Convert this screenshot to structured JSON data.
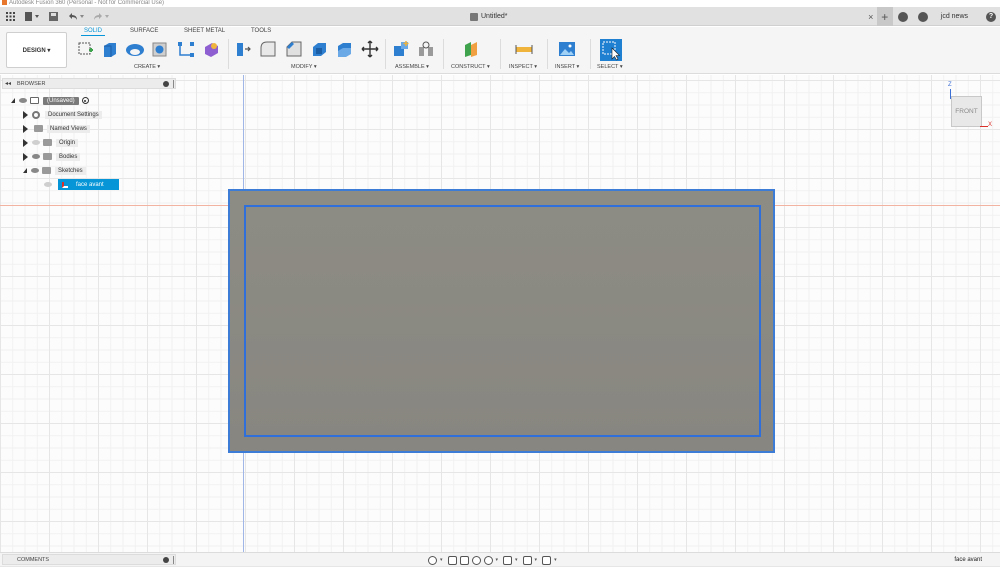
{
  "window": {
    "title": "Autodesk Fusion 360 (Personal - Not for Commercial Use)"
  },
  "topbar": {
    "document_title": "Untitled*",
    "close_glyph": "×",
    "plus_glyph": "+",
    "user": "jcd news",
    "help_glyph": "?"
  },
  "toolbar": {
    "workspace": "DESIGN ▾",
    "tabs": [
      "SOLID",
      "SURFACE",
      "SHEET METAL",
      "TOOLS"
    ],
    "active_tab": "SOLID",
    "groups": {
      "create": "CREATE ▾",
      "modify": "MODIFY ▾",
      "assemble": "ASSEMBLE ▾",
      "construct": "CONSTRUCT ▾",
      "inspect": "INSPECT ▾",
      "insert": "INSERT ▾",
      "select": "SELECT ▾"
    }
  },
  "browser": {
    "header": "BROWSER",
    "root": "(Unsaved)",
    "items": {
      "document_settings": "Document Settings",
      "named_views": "Named Views",
      "origin": "Origin",
      "bodies": "Bodies",
      "sketches": "Sketches"
    },
    "selected_sketch": "face avant"
  },
  "viewcube": {
    "face": "FRONT",
    "z_axis": "Z",
    "x_axis": "X"
  },
  "bottom": {
    "comments": "COMMENTS",
    "status": "face avant"
  },
  "colors": {
    "accent": "#0696d7",
    "face_fill": "#8b8a83",
    "sketch_edge": "#3c7bd6",
    "x_axis": "#d9302c",
    "y_axis": "#3c6fd6"
  }
}
